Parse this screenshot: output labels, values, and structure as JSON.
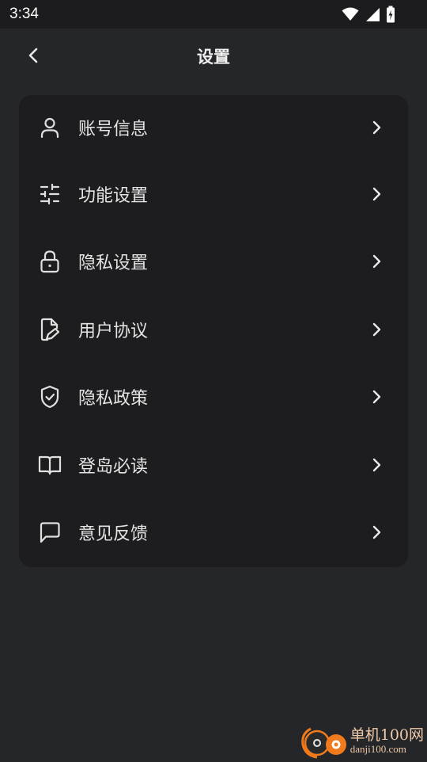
{
  "status_bar": {
    "time": "3:34"
  },
  "header": {
    "title": "设置"
  },
  "menu": {
    "items": [
      {
        "label": "账号信息",
        "icon": "user-icon"
      },
      {
        "label": "功能设置",
        "icon": "sliders-icon"
      },
      {
        "label": "隐私设置",
        "icon": "lock-icon"
      },
      {
        "label": "用户协议",
        "icon": "document-pen-icon"
      },
      {
        "label": "隐私政策",
        "icon": "shield-check-icon"
      },
      {
        "label": "登岛必读",
        "icon": "book-open-icon"
      },
      {
        "label": "意见反馈",
        "icon": "message-square-icon"
      }
    ]
  },
  "watermark": {
    "title": "单机100网",
    "url": "danji100.com"
  },
  "colors": {
    "background": "#242629",
    "card": "#1d1d1f",
    "text": "#e4e4e4",
    "watermark": "#f0c9a8",
    "watermark_logo": "#f07a1c"
  }
}
